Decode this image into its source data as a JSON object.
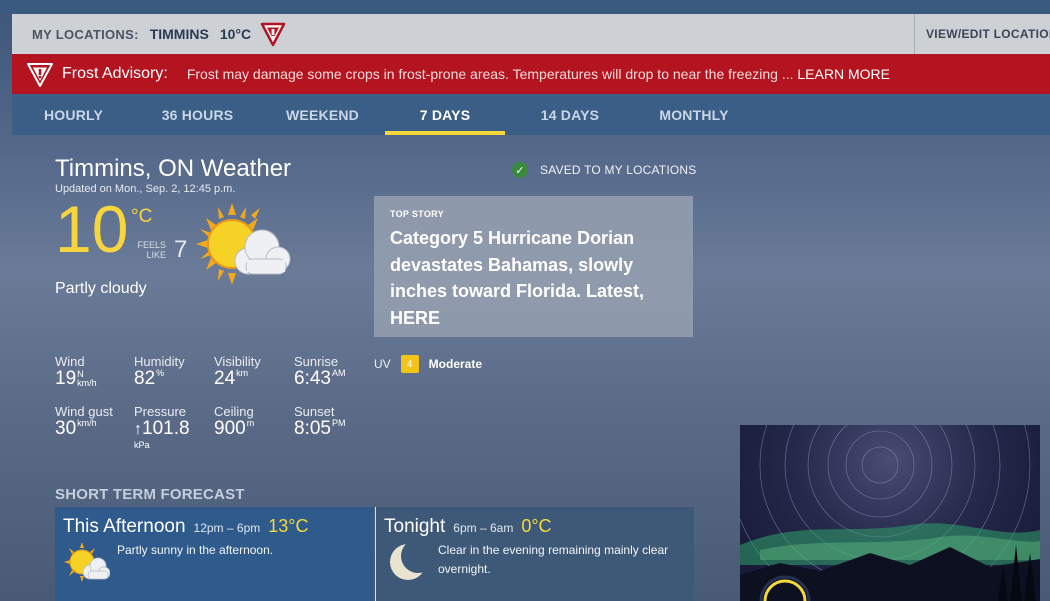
{
  "locations_bar": {
    "label": "MY LOCATIONS:",
    "city": "TIMMINS",
    "temp": "10°C",
    "view_edit": "VIEW/EDIT LOCATIONS"
  },
  "advisory": {
    "title": "Frost Advisory:",
    "message": "Frost may damage some crops in frost-prone areas. Temperatures will drop to near the freezing ...",
    "learn_more": "LEARN MORE"
  },
  "tabs": [
    {
      "label": "HOURLY"
    },
    {
      "label": "36 HOURS"
    },
    {
      "label": "WEEKEND"
    },
    {
      "label": "7 DAYS"
    },
    {
      "label": "14 DAYS"
    },
    {
      "label": "MONTHLY"
    }
  ],
  "current": {
    "title": "Timmins, ON Weather",
    "updated": "Updated on Mon., Sep. 2, 12:45 p.m.",
    "saved": "SAVED TO MY LOCATIONS",
    "temp": "10",
    "unit": "°C",
    "feels_label_1": "FEELS",
    "feels_label_2": "LIKE",
    "feels_value": "7",
    "condition": "Partly cloudy"
  },
  "top_story": {
    "label": "TOP STORY",
    "headline": "Category 5 Hurricane Dorian devastates Bahamas, slowly inches toward Florida. Latest, HERE"
  },
  "stats": {
    "wind": {
      "label": "Wind",
      "value": "19",
      "dir": "N",
      "unit": "km/h"
    },
    "humidity": {
      "label": "Humidity",
      "value": "82",
      "unit": "%"
    },
    "visibility": {
      "label": "Visibility",
      "value": "24",
      "unit": "km"
    },
    "sunrise": {
      "label": "Sunrise",
      "value": "6:43",
      "unit": "AM"
    },
    "wind_gust": {
      "label": "Wind gust",
      "value": "30",
      "unit": "km/h"
    },
    "pressure": {
      "label": "Pressure",
      "arrow": "↑",
      "value": "101.8",
      "unit": "kPa"
    },
    "ceiling": {
      "label": "Ceiling",
      "value": "900",
      "unit": "m"
    },
    "sunset": {
      "label": "Sunset",
      "value": "8:05",
      "unit": "PM"
    }
  },
  "uv": {
    "label": "UV",
    "index": "4",
    "level": "Moderate"
  },
  "short_term": {
    "heading": "SHORT TERM FORECAST",
    "afternoon": {
      "title": "This Afternoon",
      "time": "12pm – 6pm",
      "temp": "13°C",
      "desc": "Partly sunny in the afternoon."
    },
    "tonight": {
      "title": "Tonight",
      "time": "6pm – 6am",
      "temp": "0°C",
      "desc": "Clear in the evening remaining mainly clear overnight."
    }
  },
  "icons": {
    "alert": "alert-triangle-icon",
    "check": "check-icon",
    "current_weather": "partly-cloudy-icon",
    "afternoon": "partly-sunny-icon",
    "tonight": "moon-icon"
  },
  "colors": {
    "advisory_red": "#b3141f",
    "accent_yellow": "#f5d93a",
    "tab_bar": "#3b5e86"
  }
}
